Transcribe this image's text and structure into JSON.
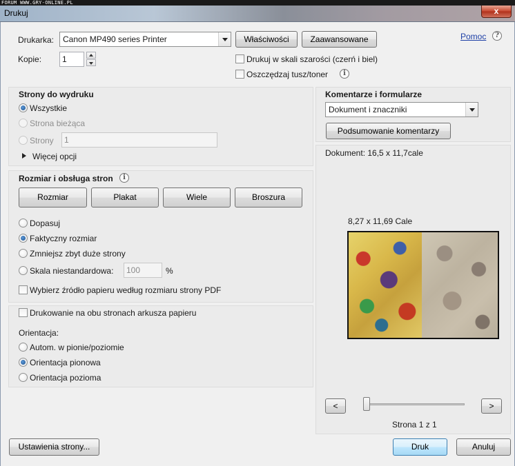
{
  "watermark": "FORUM WWW.GRY-ONLINE.PL",
  "window": {
    "title": "Drukuj",
    "close_glyph": "x"
  },
  "printer": {
    "label": "Drukarka:",
    "selected": "Canon MP490 series Printer",
    "properties_button": "Właściwości",
    "advanced_button": "Zaawansowane",
    "help_link": "Pomoc",
    "copies_label": "Kopie:",
    "copies_value": "1",
    "grayscale_label": "Drukuj w skali szarości (czerń i biel)",
    "grayscale_checked": false,
    "save_ink_label": "Oszczędzaj tusz/toner",
    "save_ink_checked": false
  },
  "pages": {
    "heading": "Strony do wydruku",
    "options": [
      {
        "label": "Wszystkie",
        "checked": true,
        "disabled": false
      },
      {
        "label": "Strona bieżąca",
        "checked": false,
        "disabled": true
      },
      {
        "label": "Strony",
        "checked": false,
        "disabled": true
      }
    ],
    "range_value": "1",
    "more_options": "Więcej opcji"
  },
  "sizing": {
    "heading": "Rozmiar i obsługa stron",
    "tabs": [
      "Rozmiar",
      "Plakat",
      "Wiele",
      "Broszura"
    ],
    "options": [
      {
        "label": "Dopasuj",
        "checked": false
      },
      {
        "label": "Faktyczny rozmiar",
        "checked": true
      },
      {
        "label": "Zmniejsz zbyt duże strony",
        "checked": false
      },
      {
        "label": "Skala niestandardowa:",
        "checked": false
      }
    ],
    "custom_scale_value": "100",
    "percent_sign": "%",
    "paper_source_label": "Wybierz źródło papieru według rozmiaru strony PDF",
    "paper_source_checked": false
  },
  "duplex": {
    "label": "Drukowanie na obu stronach arkusza papieru",
    "checked": false,
    "orientation_label": "Orientacja:",
    "orientation_options": [
      {
        "label": "Autom. w pionie/poziomie",
        "checked": false
      },
      {
        "label": "Orientacja pionowa",
        "checked": true
      },
      {
        "label": "Orientacja pozioma",
        "checked": false
      }
    ]
  },
  "comments": {
    "heading": "Komentarze i formularze",
    "selected": "Dokument i znaczniki",
    "summarize_button": "Podsumowanie komentarzy"
  },
  "preview": {
    "document_size": "Dokument: 16,5 x 11,7cale",
    "page_size": "8,27 x 11,69 Cale",
    "prev_button": "<",
    "next_button": ">",
    "page_indicator": "Strona 1 z 1",
    "slider_fraction": 0
  },
  "footer": {
    "page_setup_button": "Ustawienia strony...",
    "print_button": "Druk",
    "cancel_button": "Anuluj"
  }
}
